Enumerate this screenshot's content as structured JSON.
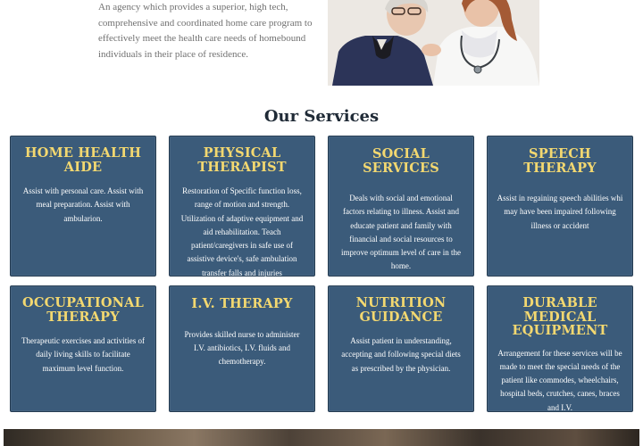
{
  "intro": {
    "text": "An agency which provides a superior, high tech, comprehensive and coordinated home care program to effectively meet the health care needs of homebound individuals in their place of residence."
  },
  "services": {
    "title": "Our Services",
    "cards": [
      {
        "title": "HOME HEALTH AIDE",
        "text": "Assist with personal care. Assist with meal preparation. Assist with ambularion."
      },
      {
        "title": "PHYSICAL THERAPIST",
        "text": "Restoration of Specific function loss, range of motion and strength. Utilization of adaptive equipment and aid rehabilitation. Teach patient/caregivers in safe use of assistive device's, safe ambulation transfer falls and injuries"
      },
      {
        "title": "SOCIAL SERVICES",
        "text": "Deals with social and emotional factors relating to illness. Assist and educate patient and family with financial and social resources to improve optimum level of care in the home."
      },
      {
        "title": "SPEECH THERAPY",
        "text": "Assist in regaining speech abilities whi may have been impaired following illness or accident"
      },
      {
        "title": "OCCUPATIONAL THERAPY",
        "text": "Therapeutic exercises and activities of daily living skills to facilitate maximum level function."
      },
      {
        "title": "I.V. THERAPY",
        "text": "Provides skilled nurse to administer I.V. antibiotics, I.V. fluids and chemotherapy."
      },
      {
        "title": "NUTRITION GUIDANCE",
        "text": "Assist patient in understanding, accepting and following special diets as prescribed by the physician."
      },
      {
        "title": "DURABLE MEDICAL EQUIPMENT",
        "text": "Arrangement for these services will be made to meet the special needs of the patient like commodes, wheelchairs, hospital beds, crutches, canes, braces and I.V."
      }
    ]
  },
  "colors": {
    "card_bg": "#3b5b7a",
    "card_title": "#f3d870",
    "heading": "#1f2a36"
  }
}
